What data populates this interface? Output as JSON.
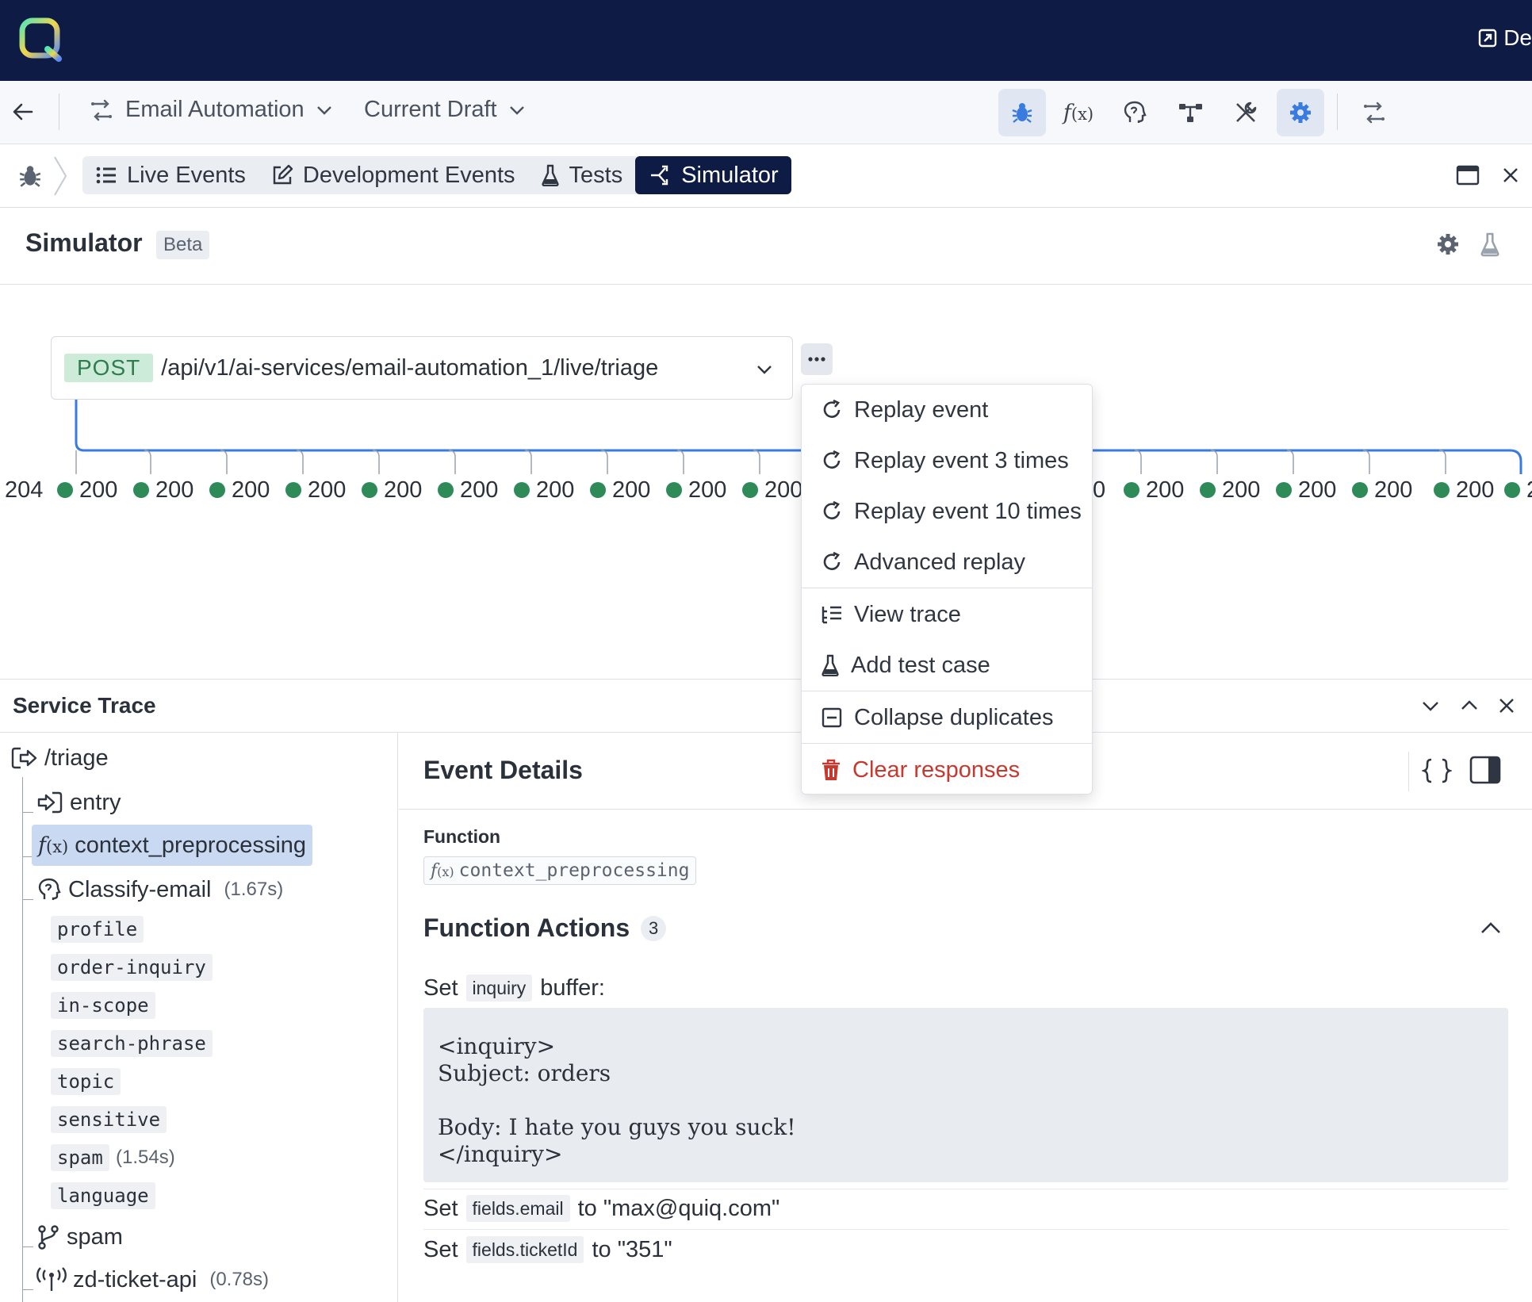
{
  "header": {
    "external_link_label": "De"
  },
  "toolbar": {
    "project": "Email Automation",
    "version": "Current Draft"
  },
  "tabs": [
    {
      "label": "Live Events"
    },
    {
      "label": "Development Events"
    },
    {
      "label": "Tests"
    },
    {
      "label": "Simulator"
    }
  ],
  "simulator": {
    "title": "Simulator",
    "badge": "Beta",
    "method": "POST",
    "endpoint": "/api/v1/ai-services/email-automation_1/live/triage"
  },
  "responses": {
    "first": "204",
    "codes": [
      "200",
      "200",
      "200",
      "200",
      "200",
      "200",
      "200",
      "200",
      "200",
      "200"
    ],
    "right_partial": "0",
    "right_codes": [
      "200",
      "200",
      "200",
      "200",
      "200"
    ],
    "last_partial": "2"
  },
  "menu": {
    "items": [
      {
        "label": "Replay event",
        "icon": "replay-icon"
      },
      {
        "label": "Replay event 3 times",
        "icon": "replay-icon"
      },
      {
        "label": "Replay event 10 times",
        "icon": "replay-icon"
      },
      {
        "label": "Advanced replay",
        "icon": "replay-icon"
      },
      {
        "label": "View trace",
        "icon": "trace-icon"
      },
      {
        "label": "Add test case",
        "icon": "flask-icon"
      },
      {
        "label": "Collapse duplicates",
        "icon": "collapse-icon"
      },
      {
        "label": "Clear responses",
        "icon": "trash-icon"
      }
    ],
    "danger_color": "#c7392e"
  },
  "trace": {
    "title": "Service Trace",
    "root": "/triage",
    "nodes": {
      "entry": "entry",
      "context": "context_preprocessing",
      "classify": "Classify-email",
      "classify_duration": "(1.67s)",
      "spam": "spam",
      "zd": "zd-ticket-api",
      "zd_duration": "(0.78s)"
    },
    "classify_children": [
      "profile",
      "order-inquiry",
      "in-scope",
      "search-phrase",
      "topic",
      "sensitive",
      "spam",
      "language"
    ],
    "spam_child_duration": "(1.54s)"
  },
  "details": {
    "title": "Event Details",
    "function_label": "Function",
    "function_name": "context_preprocessing",
    "actions_title": "Function Actions",
    "actions_count": "3",
    "action1_set": "Set",
    "action1_field": "inquiry",
    "action1_suffix": "buffer:",
    "action1_value": "<inquiry>\nSubject: orders\n\nBody: I hate you guys you suck!\n</inquiry>",
    "action2_set": "Set",
    "action2_field": "fields.email",
    "action2_suffix": "to \"max@quiq.com\"",
    "action3_set": "Set",
    "action3_field": "fields.ticketId",
    "action3_suffix": "to \"351\""
  },
  "colors": {
    "nav_dark": "#0d1b45",
    "accent": "#3a7be0",
    "success": "#2e8a57"
  }
}
